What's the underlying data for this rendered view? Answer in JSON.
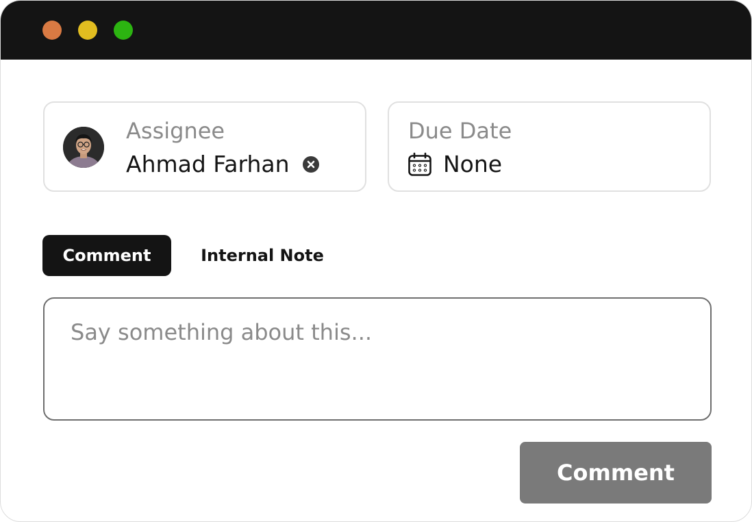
{
  "window": {
    "controls": [
      "close",
      "minimize",
      "maximize"
    ]
  },
  "assignee": {
    "label": "Assignee",
    "name": "Ahmad Farhan",
    "avatar_icon": "user-avatar",
    "clear_icon": "clear-x-icon"
  },
  "due_date": {
    "label": "Due Date",
    "value": "None",
    "icon": "calendar-icon"
  },
  "tabs": [
    {
      "label": "Comment",
      "active": true
    },
    {
      "label": "Internal Note",
      "active": false
    }
  ],
  "comment_input": {
    "value": "",
    "placeholder": "Say something about this..."
  },
  "submit": {
    "label": "Comment"
  },
  "colors": {
    "titlebar": "#141414",
    "close": "#d97a43",
    "minimize": "#e2bd20",
    "maximize": "#2cb411",
    "button_disabled": "#7a7a7a"
  }
}
